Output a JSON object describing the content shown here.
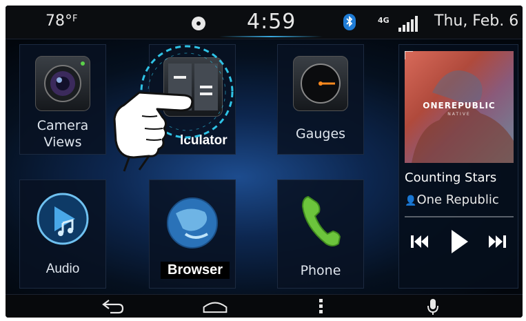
{
  "status_bar": {
    "temperature": "78°",
    "temperature_unit": "F",
    "time": "4:59",
    "network": "4G",
    "date": "Thu, Feb. 6"
  },
  "tiles": {
    "camera": {
      "label_line1": "Camera",
      "label_line2": "Views"
    },
    "calculator": {
      "label": "lculator"
    },
    "gauges": {
      "label": "Gauges"
    },
    "audio": {
      "label": "Audio"
    },
    "browser": {
      "label": "Browser"
    },
    "phone": {
      "label": "Phone"
    }
  },
  "media": {
    "album_band": "ONEREPUBLIC",
    "album_sub": "NATIVE",
    "song": "Counting Stars",
    "artist": "One Republic"
  },
  "nav": {
    "items": [
      "back-icon",
      "home-icon",
      "menu-icon",
      "voice-icon"
    ]
  },
  "colors": {
    "accent_blue": "#3aa9e0",
    "phone_green": "#6cc43c",
    "bluetooth": "#1f7cd6"
  }
}
